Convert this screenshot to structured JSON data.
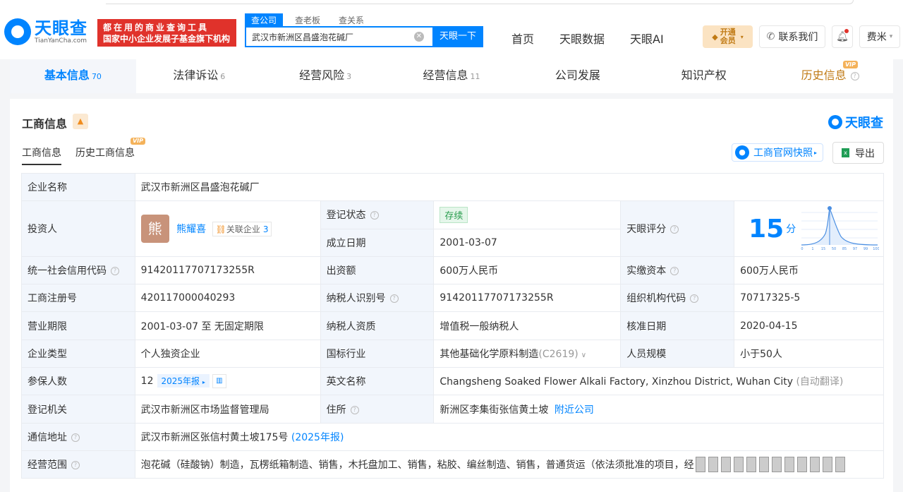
{
  "header": {
    "logo_cn": "天眼查",
    "logo_en": "TianYanCha.com",
    "slogan_line1": "都在用的商业查询工具",
    "slogan_line2": "国家中小企业发展子基金旗下机构",
    "search_tabs": [
      "查公司",
      "查老板",
      "查关系"
    ],
    "search_value": "武汉市新洲区昌盛泡花碱厂",
    "search_button": "天眼一下",
    "nav": [
      "首页",
      "天眼数据",
      "天眼AI"
    ],
    "vip_label": "开通会员",
    "contact_label": "联系我们",
    "user_label": "费米"
  },
  "tabs": [
    {
      "label": "基本信息",
      "count": "70"
    },
    {
      "label": "法律诉讼",
      "count": "6"
    },
    {
      "label": "经营风险",
      "count": "3"
    },
    {
      "label": "经营信息",
      "count": "11"
    },
    {
      "label": "公司发展",
      "count": ""
    },
    {
      "label": "知识产权",
      "count": ""
    },
    {
      "label": "历史信息",
      "count": "",
      "vip": "VIP"
    }
  ],
  "section": {
    "title": "工商信息",
    "brand": "天眼查",
    "subtabs": [
      "工商信息",
      "历史工商信息"
    ],
    "subtab_vip": "VIP",
    "snapshot_button": "工商官网快照",
    "export_button": "导出"
  },
  "info": {
    "company_name_label": "企业名称",
    "company_name": "武汉市新洲区昌盛泡花碱厂",
    "investor_label": "投资人",
    "investor_avatar": "熊",
    "investor_name": "熊耀喜",
    "related_label": "关联企业",
    "related_count": "3",
    "reg_status_label": "登记状态",
    "reg_status": "存续",
    "found_date_label": "成立日期",
    "found_date": "2001-03-07",
    "score_label": "天眼评分",
    "score": "15",
    "score_unit": "分",
    "credit_code_label": "统一社会信用代码",
    "credit_code": "91420117707173255R",
    "capital_label": "出资额",
    "capital": "600万人民币",
    "paid_capital_label": "实缴资本",
    "paid_capital": "600万人民币",
    "reg_no_label": "工商注册号",
    "reg_no": "420117000040293",
    "taxpayer_id_label": "纳税人识别号",
    "taxpayer_id": "91420117707173255R",
    "org_code_label": "组织机构代码",
    "org_code": "70717325-5",
    "term_label": "营业期限",
    "term": "2001-03-07 至 无固定期限",
    "taxpayer_qual_label": "纳税人资质",
    "taxpayer_qual": "增值税一般纳税人",
    "approve_date_label": "核准日期",
    "approve_date": "2020-04-15",
    "type_label": "企业类型",
    "type": "个人独资企业",
    "industry_label": "国标行业",
    "industry": "其他基础化学原料制造",
    "industry_code": "(C2619)",
    "staff_label": "人员规模",
    "staff": "小于50人",
    "insured_label": "参保人数",
    "insured": "12",
    "insured_report": "2025年报",
    "english_label": "英文名称",
    "english_name": "Changsheng Soaked Flower Alkali Factory, Xinzhou District, Wuhan City",
    "english_note": "(自动翻译)",
    "authority_label": "登记机关",
    "authority": "武汉市新洲区市场监督管理局",
    "address_label": "住所",
    "address": "新洲区李集街张信黄土坡",
    "nearby": "附近公司",
    "mail_label": "通信地址",
    "mail_address": "武汉市新洲区张信村黄土坡175号",
    "mail_report": "(2025年报)",
    "scope_label": "经营范围",
    "scope": "泡花碱（硅酸钠）制造，瓦楞纸箱制造、销售，木托盘加工、销售，粘胶、编丝制造、销售，普通货运（依法须批准的项目，经"
  },
  "score_chart": {
    "x_ticks": [
      "0",
      "1",
      "15",
      "50",
      "85",
      "97",
      "99",
      "100"
    ]
  }
}
